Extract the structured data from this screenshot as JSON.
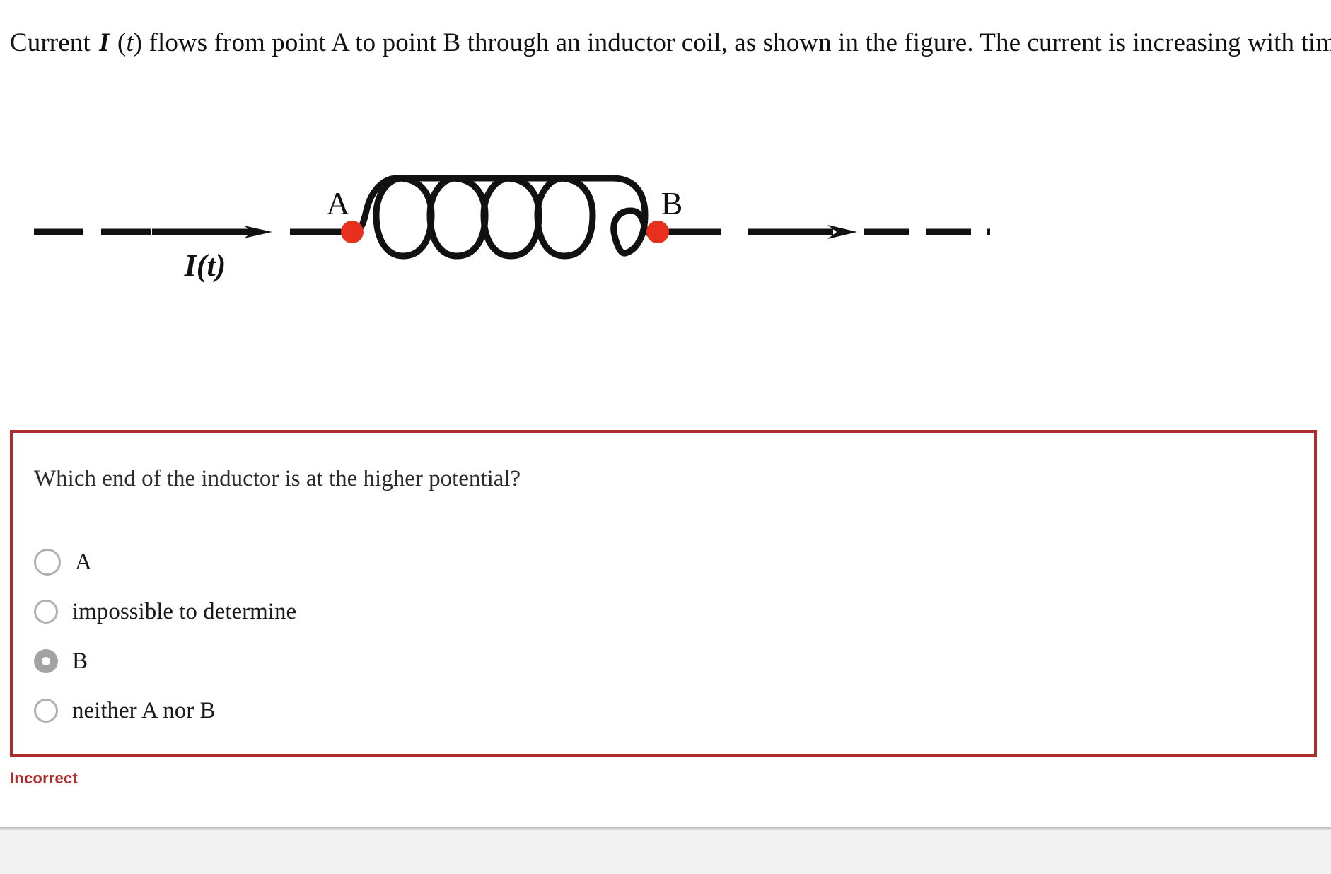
{
  "prompt": {
    "part1": "Current ",
    "symbol_i": "I",
    "paren_open": " (",
    "symbol_t": "t",
    "paren_close": ") ",
    "part2": "flows from point A to point B through an inductor coil, as shown in the figure. The current is increasing with time."
  },
  "figure": {
    "current_label": "I(t)",
    "point_a_label": "A",
    "point_b_label": "B",
    "terminal_dot_color": "#e8301f",
    "wire_color": "#111111",
    "coil_turns": 5
  },
  "question": {
    "text": "Which end of the inductor is at the higher potential?",
    "border_color": "#b02b2c",
    "options": [
      {
        "label": "A",
        "selected": false
      },
      {
        "label": "impossible to determine",
        "selected": false
      },
      {
        "label": "B",
        "selected": true
      },
      {
        "label": "neither A nor B",
        "selected": false
      }
    ]
  },
  "feedback": {
    "text": "Incorrect",
    "color": "#b02b2c"
  }
}
